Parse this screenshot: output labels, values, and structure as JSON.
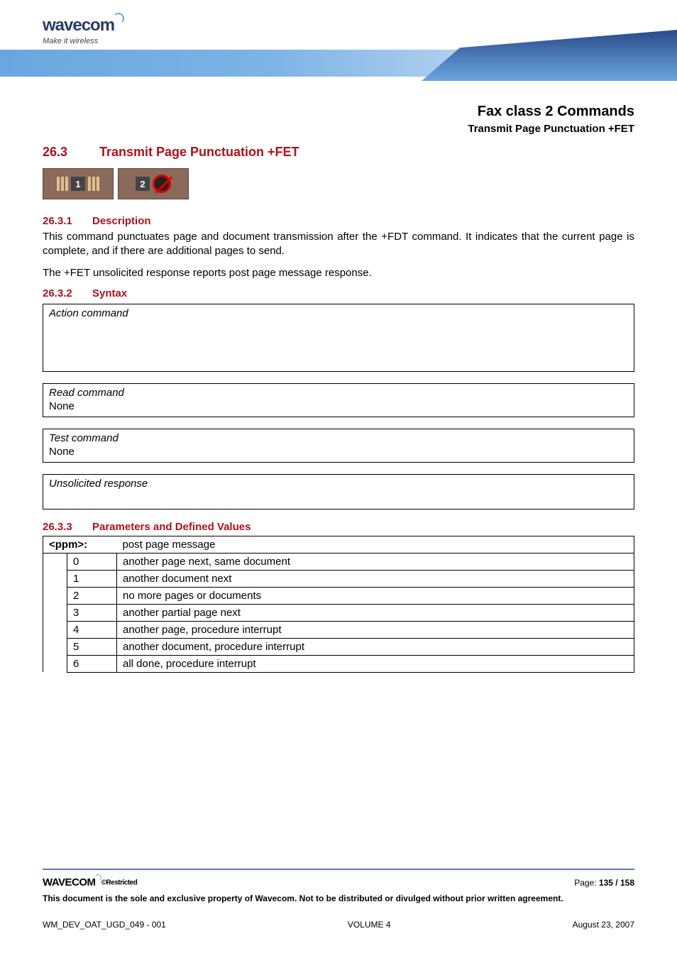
{
  "header": {
    "logo_text": "wavecom",
    "tagline": "Make it wireless"
  },
  "title": {
    "main": "Fax class 2 Commands",
    "sub": "Transmit Page Punctuation +FET"
  },
  "section": {
    "number": "26.3",
    "heading": "Transmit Page Punctuation +FET"
  },
  "icons": {
    "badge1_num": "1",
    "badge2_num": "2"
  },
  "desc": {
    "number": "26.3.1",
    "heading": "Description",
    "para1": "This command punctuates page and document transmission after the +FDT command. It indicates that the current page is complete, and if there are additional pages to send.",
    "para2": "The +FET unsolicited response reports post page message response."
  },
  "syntax": {
    "number": "26.3.2",
    "heading": "Syntax",
    "action_label": "Action command",
    "read_label": "Read command",
    "read_value": "None",
    "test_label": "Test command",
    "test_value": "None",
    "unsolicited_label": "Unsolicited response"
  },
  "params": {
    "number": "26.3.3",
    "heading": "Parameters and Defined Values",
    "name": "<ppm>:",
    "name_desc": "post page message",
    "rows": [
      {
        "code": "0",
        "desc": "another page next, same document"
      },
      {
        "code": "1",
        "desc": "another document next"
      },
      {
        "code": "2",
        "desc": "no more pages or documents"
      },
      {
        "code": "3",
        "desc": "another partial page next"
      },
      {
        "code": "4",
        "desc": "another page, procedure interrupt"
      },
      {
        "code": "5",
        "desc": "another document, procedure interrupt"
      },
      {
        "code": "6",
        "desc": "all done, procedure interrupt"
      }
    ]
  },
  "footer": {
    "logo": "WAVECOM",
    "restricted": "©Restricted",
    "page_label": "Page: ",
    "page_value": "135 / 158",
    "disclaimer": "This document is the sole and exclusive property of Wavecom. Not to be distributed or divulged without prior written agreement.",
    "doc_id": "WM_DEV_OAT_UGD_049 - 001",
    "volume": "VOLUME 4",
    "date": "August 23, 2007"
  }
}
